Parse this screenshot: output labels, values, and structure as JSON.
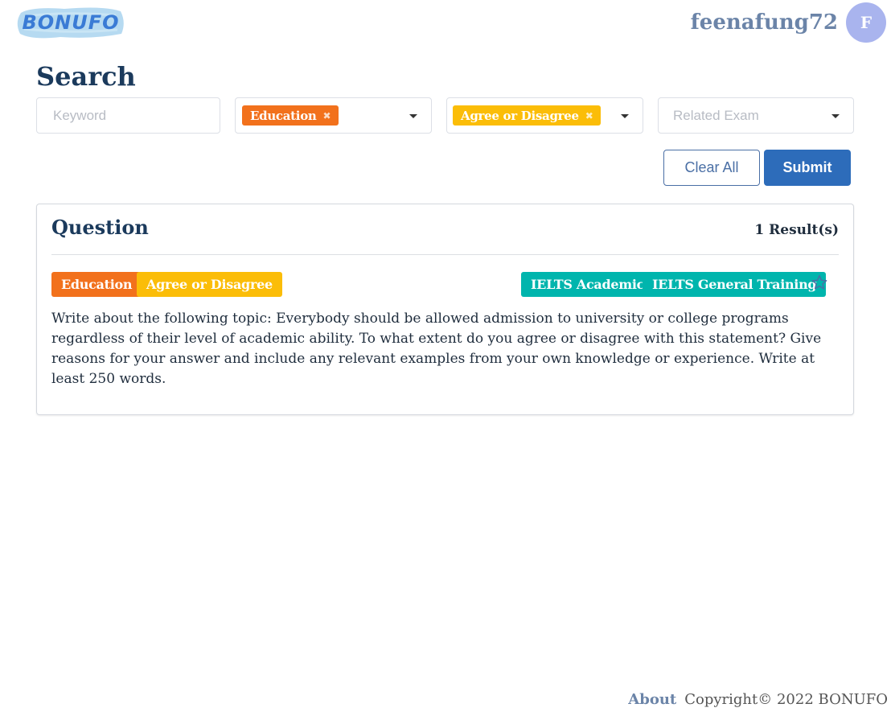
{
  "header": {
    "logo_text": "BONUFO",
    "username": "feenafung72",
    "avatar_letter": "F"
  },
  "search": {
    "title": "Search",
    "keyword_placeholder": "Keyword",
    "topic_chip": "Education",
    "type_chip": "Agree or Disagree",
    "exam_placeholder": "Related Exam",
    "clear_label": "Clear All",
    "submit_label": "Submit"
  },
  "results": {
    "title": "Question",
    "count": "1 Result(s)",
    "items": [
      {
        "tags": [
          "Education",
          "Agree or Disagree"
        ],
        "exams": [
          "IELTS Academic",
          "IELTS General Training"
        ],
        "text": "Write about the following topic: Everybody should be allowed admission to university or college programs regardless of their level of academic ability. To what extent do you agree or disagree with this statement? Give reasons for your answer and include any relevant examples from your own knowledge or experience. Write at least 250 words."
      }
    ]
  },
  "footer": {
    "about": "About",
    "copyright": "Copyright© 2022 BONUFO"
  },
  "colors": {
    "orange": "#f2711c",
    "yellow": "#fbbd08",
    "teal": "#00b5ad",
    "primary": "#2d6cba",
    "heading": "#1b3a5c",
    "avatar": "#a9b4ee"
  },
  "icons": {
    "chip_remove": "close-icon",
    "dropdown": "caret-down-icon",
    "favorite": "star-outline-icon"
  }
}
